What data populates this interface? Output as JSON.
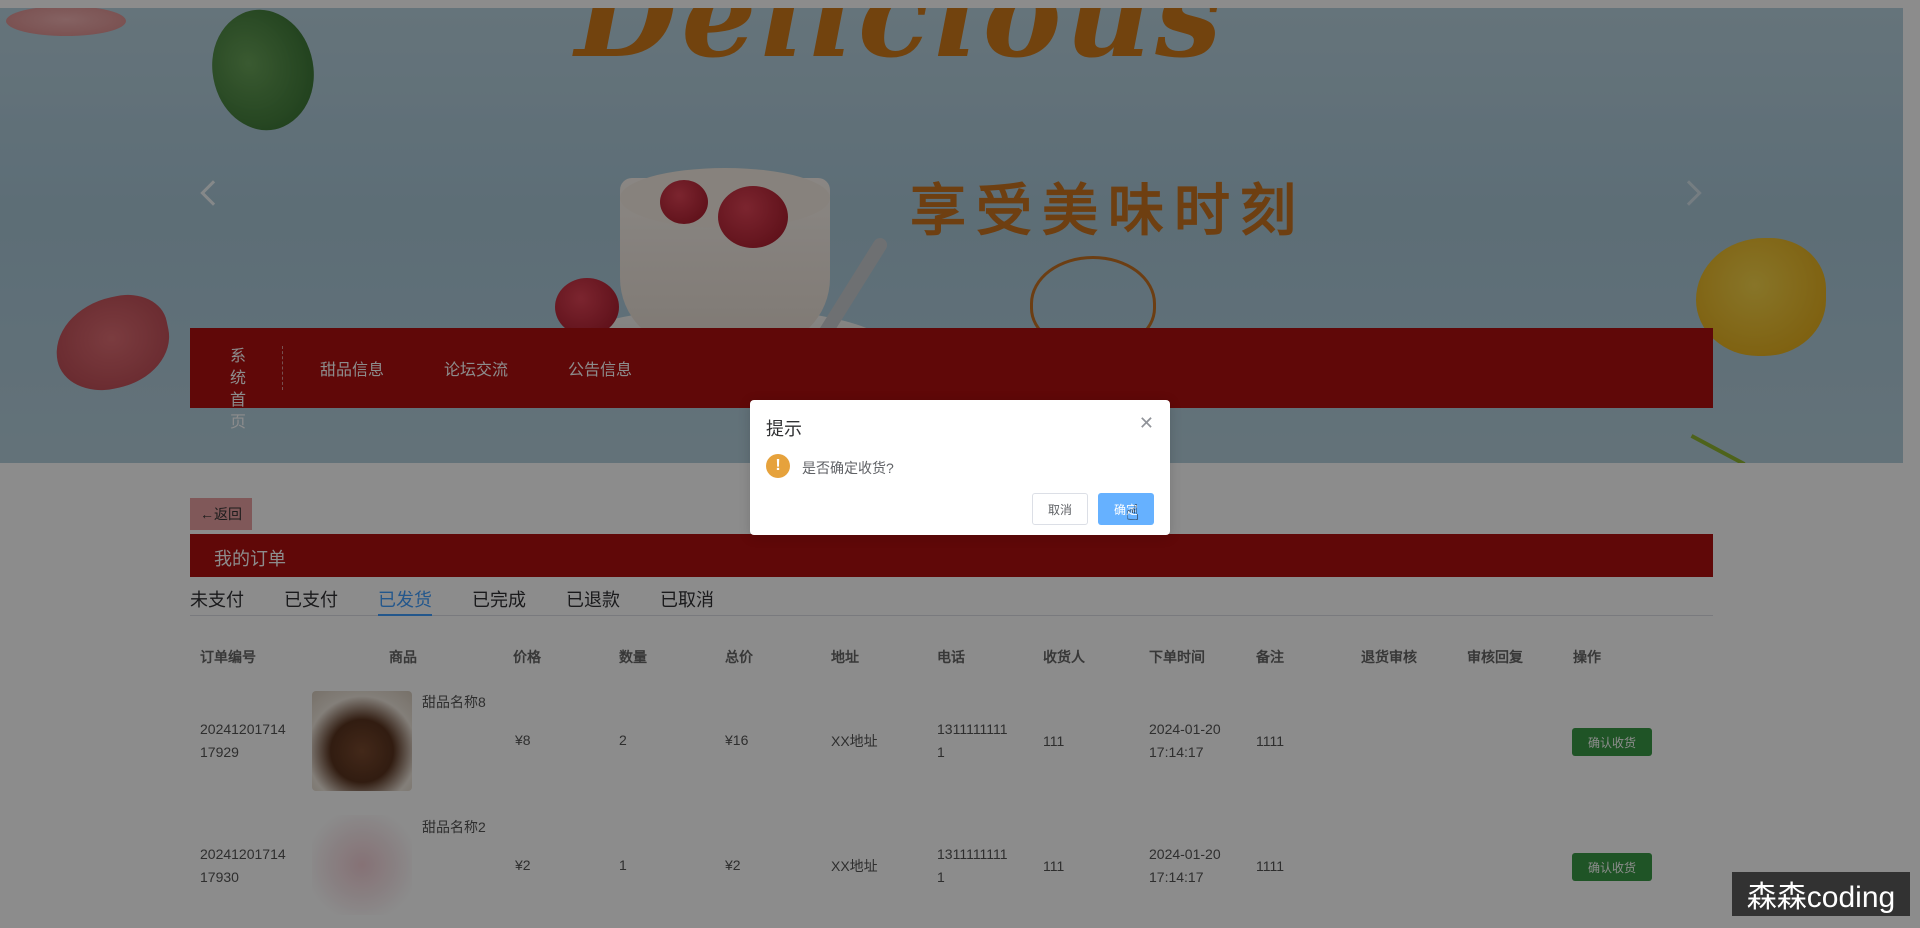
{
  "banner": {
    "title": "Delicious",
    "slogan": "享受美味时刻"
  },
  "nav": {
    "home_line1": "系统",
    "home_line2": "首页",
    "items": [
      "甜品信息",
      "论坛交流",
      "公告信息"
    ]
  },
  "orders": {
    "back_label": "←返回",
    "title": "我的订单",
    "tabs": [
      "未支付",
      "已支付",
      "已发货",
      "已完成",
      "已退款",
      "已取消"
    ],
    "active_tab": "已发货",
    "columns": [
      "订单编号",
      "商品",
      "价格",
      "数量",
      "总价",
      "地址",
      "电话",
      "收货人",
      "下单时间",
      "备注",
      "退货审核",
      "审核回复",
      "操作"
    ],
    "rows": [
      {
        "order_no_1": "20241201714",
        "order_no_2": "17929",
        "product": "甜品名称8",
        "price": "¥8",
        "qty": "2",
        "total": "¥16",
        "address": "XX地址",
        "phone_1": "1311111111",
        "phone_2": "1",
        "receiver": "111",
        "time_1": "2024-01-20",
        "time_2": "17:14:17",
        "note": "1111",
        "action": "确认收货"
      },
      {
        "order_no_1": "20241201714",
        "order_no_2": "17930",
        "product": "甜品名称2",
        "price": "¥2",
        "qty": "1",
        "total": "¥2",
        "address": "XX地址",
        "phone_1": "1311111111",
        "phone_2": "1",
        "receiver": "111",
        "time_1": "2024-01-20",
        "time_2": "17:14:17",
        "note": "1111",
        "action": "确认收货"
      }
    ]
  },
  "dialog": {
    "title": "提示",
    "message": "是否确定收货?",
    "cancel_label": "取消",
    "confirm_label": "确定"
  },
  "watermark": "森森coding",
  "colors": {
    "brand_red": "#b00f10",
    "active_tab": "#409eff",
    "action_green": "#3a9a45",
    "warning": "#e6a23c",
    "confirm": "#66b1ff"
  },
  "icons": [
    "chevron-left-icon",
    "chevron-right-icon",
    "close-icon",
    "warning-icon",
    "hand-cursor-icon"
  ]
}
